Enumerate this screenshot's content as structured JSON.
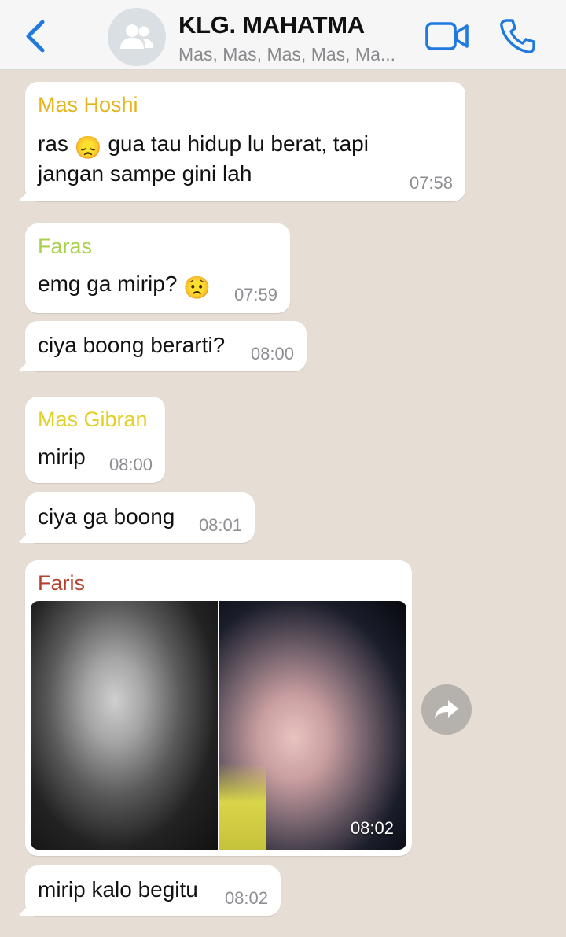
{
  "header": {
    "title": "KLG. MAHATMA",
    "subtitle": "Mas, Mas, Mas, Mas, Ma...",
    "back_icon": "chevron-left-icon",
    "avatar_icon": "group-icon",
    "video_icon": "video-camera-icon",
    "call_icon": "phone-icon",
    "accent_color": "#1f7ae0"
  },
  "messages": [
    {
      "sender": "Mas Hoshi",
      "sender_color": "#e6b41e",
      "line1_before": "ras",
      "emoji": "😞",
      "line1_after": "gua tau hidup lu berat, tapi",
      "line2": "jangan sampe gini lah",
      "time": "07:58"
    },
    {
      "sender": "Faras",
      "sender_color": "#a9d14f",
      "text": "emg ga mirip?",
      "emoji": "😟",
      "time": "07:59"
    },
    {
      "text": "ciya boong berarti?",
      "time": "08:00"
    },
    {
      "sender": "Mas Gibran",
      "sender_color": "#e2d02a",
      "text": "mirip",
      "time": "08:00"
    },
    {
      "text": "ciya ga boong",
      "time": "08:01"
    },
    {
      "sender": "Faris",
      "sender_color": "#b5412f",
      "time": "08:02",
      "forward_icon": "forward-arrow-icon"
    },
    {
      "text": "mirip kalo begitu",
      "time": "08:02"
    }
  ]
}
